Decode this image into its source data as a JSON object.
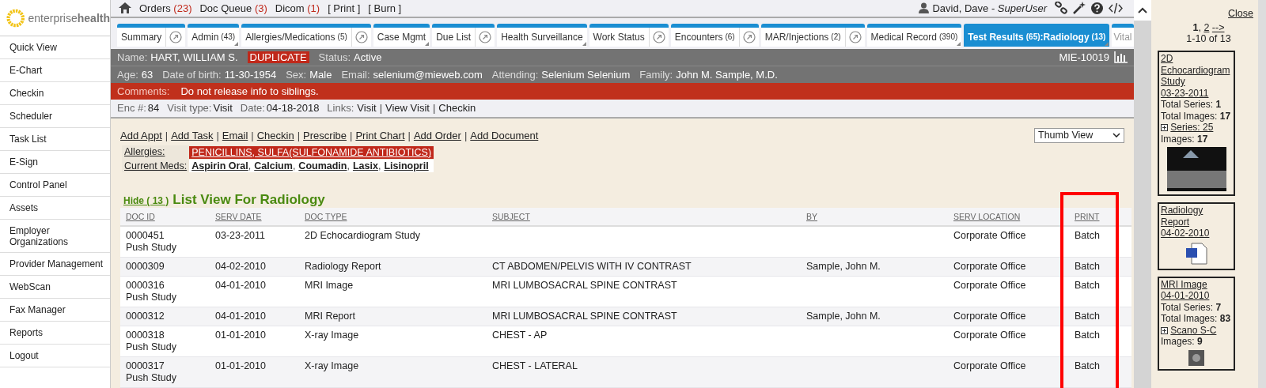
{
  "logo": {
    "text": "enterprise**health**"
  },
  "sidebar": {
    "items": [
      "Quick View",
      "E-Chart",
      "Checkin",
      "Scheduler",
      "Task List",
      "E-Sign",
      "Control Panel",
      "Assets",
      "Employer Organizations",
      "Provider Management",
      "WebScan",
      "Fax Manager",
      "Reports",
      "Logout"
    ]
  },
  "top_links": [
    {
      "label": "Orders",
      "count": "(23)"
    },
    {
      "label": "Doc Queue",
      "count": "(3)"
    },
    {
      "label": "Dicom",
      "count": "(1)"
    },
    {
      "label": "[ Print ]"
    },
    {
      "label": "[ Burn ]"
    }
  ],
  "user": {
    "name": "David, Dave",
    "separator": "-",
    "role": "SuperUser"
  },
  "tabs": [
    {
      "label": "Summary",
      "kind": "popout",
      "selected": false
    },
    {
      "label": "Admin",
      "count": "(43)",
      "kind": "menu",
      "selected": false
    },
    {
      "label": "Allergies/Medications",
      "count": "(5)",
      "kind": "popout",
      "selected": false
    },
    {
      "label": "Case Mgmt",
      "kind": "menu",
      "selected": false
    },
    {
      "label": "Due List",
      "kind": "popout",
      "selected": false
    },
    {
      "label": "Health Surveillance",
      "kind": "menu",
      "selected": false
    },
    {
      "label": "Work Status",
      "kind": "popout",
      "selected": false
    },
    {
      "label": "Encounters",
      "count": "(6)",
      "kind": "popout",
      "selected": false
    },
    {
      "label": "MAR/Injections",
      "count": "(2)",
      "kind": "popout",
      "selected": false
    },
    {
      "label": "Medical Record",
      "count": "(390)",
      "kind": "menu",
      "selected": false
    },
    {
      "label": "Test Results",
      "count": "(65)",
      "sub": ":Radiology",
      "sub_count": "(13)",
      "kind": "menu",
      "selected": true
    },
    {
      "label": "Vital",
      "kind": "cut",
      "selected": false
    }
  ],
  "patient": {
    "fields": [
      {
        "label": "Name:",
        "value": "HART, WILLIAM S."
      },
      {
        "kind": "flag",
        "value": "DUPLICATE"
      },
      {
        "label": "Status:",
        "value": "Active"
      }
    ],
    "record_id": "MIE-10019"
  },
  "demographics": [
    {
      "label": "Age:",
      "value": "63"
    },
    {
      "label": "Date of birth:",
      "value": "11-30-1954"
    },
    {
      "label": "Sex:",
      "value": "Male"
    },
    {
      "label": "Email:",
      "value": "selenium@mieweb.com"
    },
    {
      "label": "Attending:",
      "value": "Selenium Selenium"
    },
    {
      "label": "Family:",
      "value": "John M. Sample, M.D."
    }
  ],
  "comments": {
    "label": "Comments:",
    "value": "Do not release info to siblings."
  },
  "encounter": {
    "fields": [
      {
        "label": "Enc #:",
        "value": "84"
      },
      {
        "label": "Visit type:",
        "value": "Visit"
      },
      {
        "label": "Date:",
        "value": "04-18-2018"
      }
    ],
    "links_label": "Links:",
    "links": [
      "Visit",
      "View Visit",
      "Checkin"
    ],
    "separator": "|"
  },
  "actions": {
    "items": [
      "Add Appt",
      "Add Task",
      "Email",
      "Checkin",
      "Prescribe",
      "Print Chart",
      "Add Order",
      "Add Document"
    ],
    "separator": "|"
  },
  "view_select": {
    "value": "Thumb View"
  },
  "allergies": {
    "label": "Allergies:",
    "value": "PENICILLINS, SULFA(SULFONAMIDE ANTIBIOTICS)"
  },
  "meds": {
    "label": "Current Meds:",
    "items": [
      "Aspirin Oral",
      "Calcium",
      "Coumadin",
      "Lasix",
      "Lisinopril"
    ],
    "separator": ","
  },
  "section": {
    "hide_link": "Hide ( 13 )",
    "title": "List View For Radiology"
  },
  "table": {
    "columns": [
      "DOC ID",
      "SERV DATE",
      "DOC TYPE",
      "SUBJECT",
      "BY",
      "SERV LOCATION",
      "PRINT"
    ],
    "rows": [
      {
        "doc_id": "0000451",
        "note": "Push Study",
        "serv_date": "03-23-2011",
        "doc_type": "2D Echocardiogram Study",
        "serv_location": "Corporate Office",
        "print": "Batch"
      },
      {
        "doc_id": "0000309",
        "serv_date": "04-02-2010",
        "doc_type": "Radiology Report",
        "subject": "CT ABDOMEN/PELVIS WITH IV CONTRAST",
        "by": "Sample, John M.",
        "serv_location": "Corporate Office",
        "print": "Batch"
      },
      {
        "doc_id": "0000316",
        "note": "Push Study",
        "serv_date": "04-01-2010",
        "doc_type": "MRI Image",
        "subject": "MRI LUMBOSACRAL SPINE CONTRAST",
        "serv_location": "Corporate Office",
        "print": "Batch"
      },
      {
        "doc_id": "0000312",
        "serv_date": "04-01-2010",
        "doc_type": "MRI Report",
        "subject": "MRI LUMBOSACRAL SPINE CONTRAST",
        "by": "Sample, John M.",
        "serv_location": "Corporate Office",
        "print": "Batch"
      },
      {
        "doc_id": "0000318",
        "note": "Push Study",
        "serv_date": "01-01-2010",
        "doc_type": "X-ray Image",
        "subject": "CHEST - AP",
        "serv_location": "Corporate Office",
        "print": "Batch"
      },
      {
        "doc_id": "0000317",
        "note": "Push Study",
        "serv_date": "01-01-2010",
        "doc_type": "X-ray Image",
        "subject": "CHEST - LATERAL",
        "serv_location": "Corporate Office",
        "print": "Batch"
      }
    ]
  },
  "thumb_panel": {
    "close": "Close",
    "separator": ",",
    "pages": [
      {
        "label": "1",
        "selected": true
      },
      {
        "label": "2",
        "selected": false
      }
    ],
    "next": "-->",
    "range": "1-10 of 13",
    "cards": [
      {
        "title": "2D Echocardiogram Study",
        "date": "03-23-2011",
        "stats": [
          {
            "label": "Total Series:",
            "value": "1"
          },
          {
            "label": "Total Images:",
            "value": "17"
          }
        ],
        "series": "Series: 25",
        "images": {
          "label": "Images:",
          "value": "17"
        },
        "kind": "scan"
      },
      {
        "title": "Radiology Report",
        "date": "04-02-2010",
        "kind": "document"
      },
      {
        "title": "MRI Image",
        "date": "04-01-2010",
        "stats": [
          {
            "label": "Total Series:",
            "value": "7"
          },
          {
            "label": "Total Images:",
            "value": "83"
          }
        ],
        "series": "Scano S-C",
        "images": {
          "label": "Images:",
          "value": "9"
        },
        "kind": "small-scan"
      }
    ]
  }
}
